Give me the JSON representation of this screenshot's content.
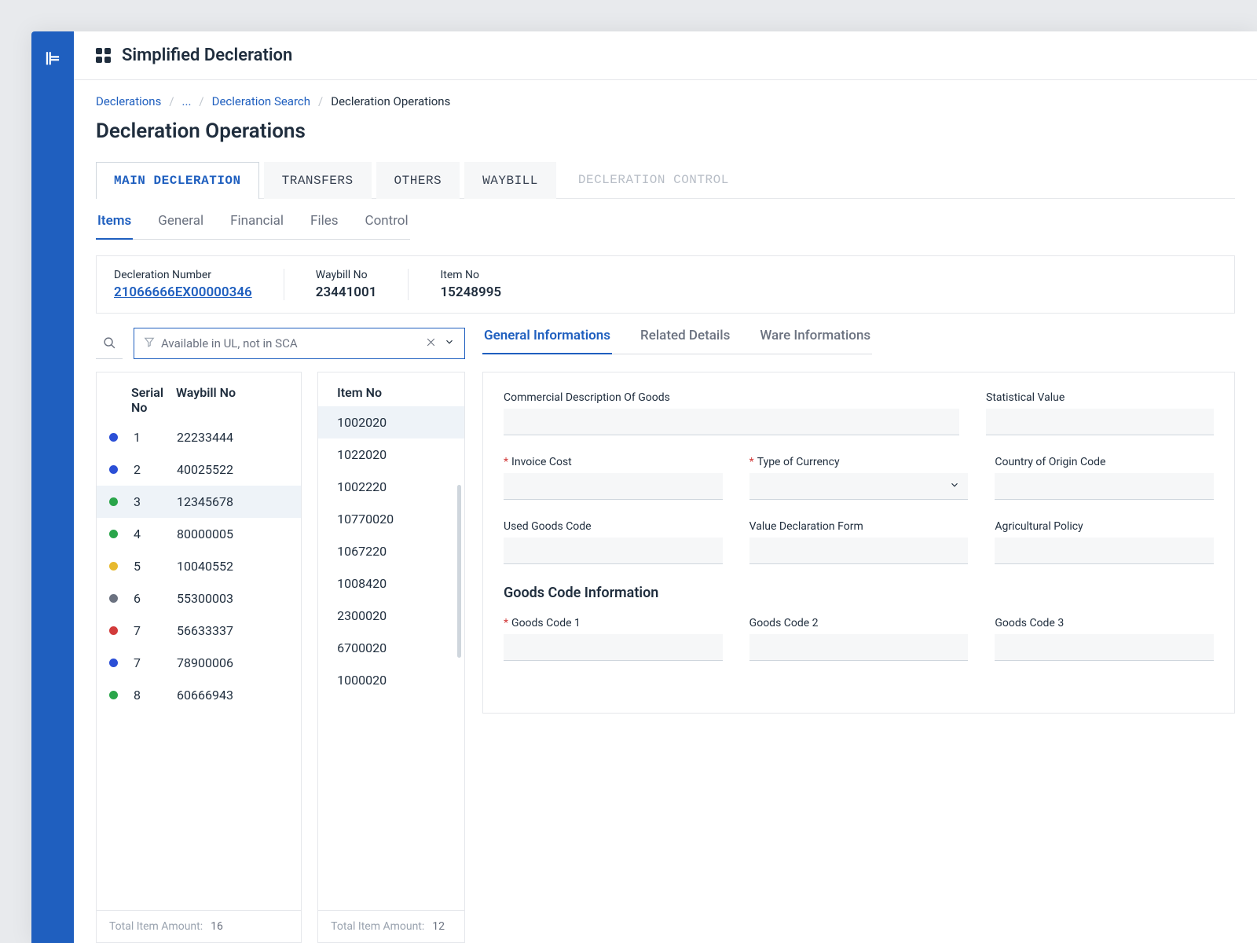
{
  "header": {
    "title": "Simplified Decleration"
  },
  "breadcrumbs": {
    "root": "Declerations",
    "ellipsis": "...",
    "search": "Decleration Search",
    "current": "Decleration Operations"
  },
  "page_title": "Decleration Operations",
  "top_tabs": [
    {
      "label": "MAIN DECLERATION",
      "state": "active"
    },
    {
      "label": "TRANSFERS",
      "state": "normal"
    },
    {
      "label": "OTHERS",
      "state": "normal"
    },
    {
      "label": "WAYBILL",
      "state": "normal"
    },
    {
      "label": "DECLERATION CONTROL",
      "state": "disabled"
    }
  ],
  "sub_tabs": [
    {
      "label": "Items",
      "state": "active"
    },
    {
      "label": "General",
      "state": "normal"
    },
    {
      "label": "Financial",
      "state": "normal"
    },
    {
      "label": "Files",
      "state": "normal"
    },
    {
      "label": "Control",
      "state": "normal"
    }
  ],
  "info_strip": {
    "decl_number_label": "Decleration Number",
    "decl_number_value": "21066666EX00000346",
    "waybill_label": "Waybill No",
    "waybill_value": "23441001",
    "item_label": "Item No",
    "item_value": "15248995"
  },
  "filter": {
    "text": "Available in UL, not in SCA"
  },
  "waybill_list": {
    "col_serial": "Serial No",
    "col_waybill": "Waybill No",
    "rows": [
      {
        "color": "#2b4fd6",
        "serial": "1",
        "waybill": "22233444"
      },
      {
        "color": "#2b4fd6",
        "serial": "2",
        "waybill": "40025522"
      },
      {
        "color": "#2aa54a",
        "serial": "3",
        "waybill": "12345678",
        "selected": true
      },
      {
        "color": "#2aa54a",
        "serial": "4",
        "waybill": "80000005"
      },
      {
        "color": "#e7b92e",
        "serial": "5",
        "waybill": "10040552"
      },
      {
        "color": "#6b7280",
        "serial": "6",
        "waybill": "55300003"
      },
      {
        "color": "#d23b3b",
        "serial": "7",
        "waybill": "56633337"
      },
      {
        "color": "#2b4fd6",
        "serial": "7",
        "waybill": "78900006"
      },
      {
        "color": "#2aa54a",
        "serial": "8",
        "waybill": "60666943"
      }
    ],
    "footer_label": "Total Item Amount:",
    "footer_value": "16"
  },
  "item_list": {
    "col_item": "Item No",
    "rows": [
      {
        "item": "1002020",
        "selected": true
      },
      {
        "item": "1022020"
      },
      {
        "item": "1002220"
      },
      {
        "item": "10770020"
      },
      {
        "item": "1067220"
      },
      {
        "item": "1008420"
      },
      {
        "item": "2300020"
      },
      {
        "item": "6700020"
      },
      {
        "item": "1000020"
      }
    ],
    "footer_label": "Total Item Amount:",
    "footer_value": "12"
  },
  "right_tabs": [
    {
      "label": "General Informations",
      "state": "active"
    },
    {
      "label": "Related Details",
      "state": "normal"
    },
    {
      "label": "Ware Informations",
      "state": "normal"
    }
  ],
  "form": {
    "commercial_desc": "Commercial Description Of Goods",
    "statistical_value": "Statistical Value",
    "invoice_cost": "Invoice Cost",
    "type_currency": "Type of Currency",
    "origin_code": "Country of Origin Code",
    "used_goods": "Used Goods Code",
    "value_decl": "Value Declaration Form",
    "agri_policy": "Agricultural Policy",
    "section_goods": "Goods Code Information",
    "goods1": "Goods Code 1",
    "goods2": "Goods Code 2",
    "goods3": "Goods Code 3"
  }
}
